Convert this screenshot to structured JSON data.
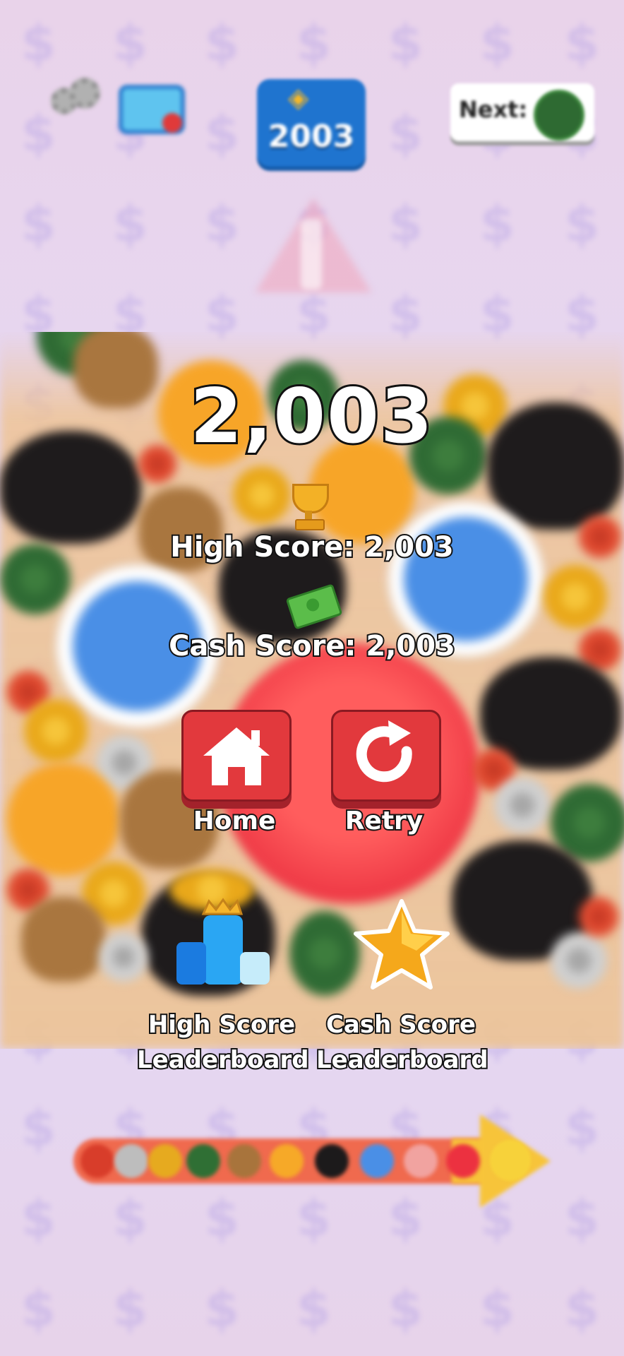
{
  "header": {
    "score_badge_value": "2003",
    "next_label": "Next:"
  },
  "result": {
    "score": "2,003",
    "high_score_text": "High Score: 2,003",
    "cash_score_text": "Cash Score: 2,003"
  },
  "buttons": {
    "home_label": "Home",
    "retry_label": "Retry"
  },
  "leaderboards": {
    "high_score_line1": "High Score",
    "high_score_line2": "Leaderboard",
    "cash_score_line1": "Cash Score",
    "cash_score_line2": "Leaderboard"
  },
  "icons": {
    "settings": "gear-icon",
    "ads": "tv-icon",
    "trophy": "trophy-icon",
    "cash": "cash-icon",
    "home": "home-icon",
    "retry": "retry-icon",
    "high_score_leaderboard": "podium-crown-icon",
    "cash_score_leaderboard": "star-icon"
  },
  "colors": {
    "button_red": "#e2393d",
    "badge_blue": "#1f74cf",
    "evo_bar": "#f06a4e",
    "evo_arrow": "#f7c43a"
  }
}
